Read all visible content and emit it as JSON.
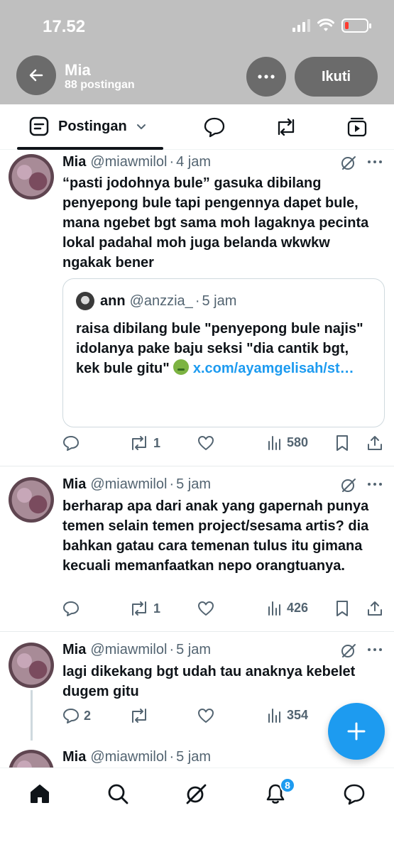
{
  "status_bar": {
    "time": "17.52"
  },
  "header": {
    "name": "Mia",
    "post_count": "88 postingan",
    "follow_label": "Ikuti"
  },
  "tabs": {
    "posts_label": "Postingan"
  },
  "posts": [
    {
      "name": "Mia",
      "handle": "@miawmilol",
      "time": "4 jam",
      "text": "“pasti jodohnya bule” gasuka dibilang penyepong bule tapi pengennya dapet bule, mana ngebet bgt sama moh lagaknya pecinta lokal padahal moh juga belanda wkwkw ngakak bener",
      "quote": {
        "name": "ann",
        "handle": "@anzzia_",
        "time": "5 jam",
        "text": "raisa dibilang bule \"penyepong bule najis\" idolanya pake baju seksi \"dia cantik bgt, kek bule gitu\"",
        "link": "x.com/ayamgelisah/st…"
      },
      "replies": "",
      "reposts": "1",
      "views": "580"
    },
    {
      "name": "Mia",
      "handle": "@miawmilol",
      "time": "5 jam",
      "text": "berharap apa dari anak yang gapernah punya temen selain temen project/sesama artis? dia bahkan gatau cara temenan tulus itu gimana kecuali memanfaatkan nepo orangtuanya.",
      "replies": "",
      "reposts": "1",
      "views": "426"
    },
    {
      "name": "Mia",
      "handle": "@miawmilol",
      "time": "5 jam",
      "text": "lagi dikekang bgt udah tau anaknya kebelet dugem gitu",
      "replies": "2",
      "reposts": "",
      "views": "354"
    },
    {
      "name": "Mia",
      "handle": "@miawmilol",
      "time": "5 jam"
    }
  ],
  "bottom_nav": {
    "notifications_badge": "8"
  },
  "colors": {
    "accent": "#1d9bf0",
    "text": "#0f1419",
    "muted": "#536471"
  }
}
